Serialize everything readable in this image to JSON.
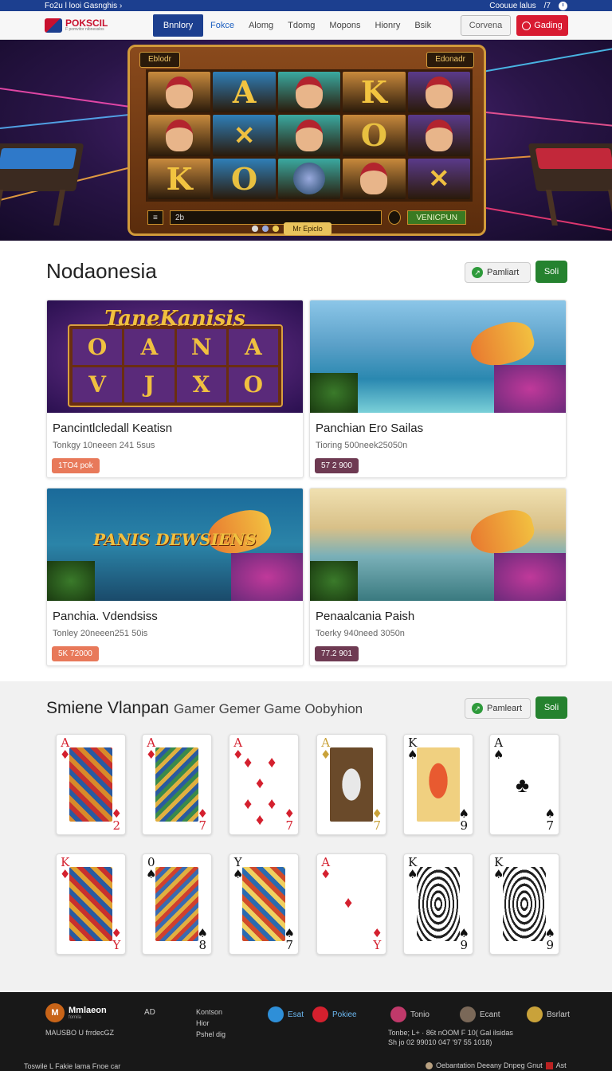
{
  "topbar": {
    "left": "Fo2u l looi Gasnghis",
    "left_arrow": "›",
    "right": "Coouue lalus",
    "right_num": "/7"
  },
  "nav": {
    "logo": "POKSCIL",
    "logo_tag": "F pomvitor nibnesslos",
    "items": [
      "Bnnlory",
      "Fokce",
      "Alomg",
      "Tdomg",
      "Mopons",
      "Hionry",
      "Bsik"
    ],
    "outline_btn": "Corvena",
    "red_btn": "Gading"
  },
  "hero": {
    "slot_title": "Eblodr",
    "slot_badge": "Edonadr",
    "bottom_left": "2b",
    "win_label": "VENICPUN",
    "control": "Mr Epiclo",
    "reel_symbols": [
      "face",
      "A",
      "face",
      "K",
      "face",
      "face",
      "swords",
      "face",
      "O",
      "face",
      "K",
      "O",
      "orb",
      "face",
      "swords"
    ]
  },
  "section1": {
    "title": "Nodaonesia",
    "pill_btn": "Pamliart",
    "green_btn": "Soli",
    "cards": [
      {
        "title": "Pancintlcledall Keatisn",
        "meta": "Tonkgy 10neeen 241 5sus",
        "badge": "1TO4 pok",
        "badge_color": "#e8795a",
        "banner": "TaneKanisis",
        "img": "slot"
      },
      {
        "title": "Panchian Ero Sailas",
        "meta": "Tioring 500neek25050n",
        "badge": "57 2 900",
        "badge_color": "#6e3a52",
        "banner": "",
        "img": "lake"
      },
      {
        "title": "Panchia. Vdendsiss",
        "meta": "Tonley 20neeen251 50is",
        "badge": "5K 72000",
        "badge_color": "#e8795a",
        "banner": "PANIS DEWSIENS",
        "img": "reef"
      },
      {
        "title": "Penaalcania Paish",
        "meta": "Toerky 940need 3050n",
        "badge": "77.2 901",
        "badge_color": "#6e3a52",
        "banner": "",
        "img": "sunset"
      }
    ]
  },
  "section2": {
    "title": "Smiene Vlanpan",
    "subtitle": "Gamer Gemer Game Oobyhion",
    "pill_btn": "Pamleart",
    "green_btn": "Soli",
    "cards": [
      {
        "rank": "A",
        "suit": "♦",
        "rank2": "2",
        "color": "#d4202e",
        "art": "pattern1"
      },
      {
        "rank": "A",
        "suit": "♦",
        "rank2": "7",
        "color": "#d4202e",
        "art": "pattern2"
      },
      {
        "rank": "A",
        "suit": "♦",
        "rank2": "7",
        "color": "#d4202e",
        "art": "pips"
      },
      {
        "rank": "A",
        "suit": "♦",
        "rank2": "7",
        "color": "#c9a23a",
        "art": "skull"
      },
      {
        "rank": "K",
        "suit": "♠",
        "rank2": "9",
        "color": "#111111",
        "art": "fish"
      },
      {
        "rank": "A",
        "suit": "♠",
        "rank2": "7",
        "color": "#111111",
        "art": "club"
      },
      {
        "rank": "K",
        "suit": "♦",
        "rank2": "Y",
        "color": "#d4202e",
        "art": "pattern3"
      },
      {
        "rank": "0",
        "suit": "♠",
        "rank2": "8",
        "color": "#111111",
        "art": "pattern4"
      },
      {
        "rank": "Y",
        "suit": "♠",
        "rank2": "7",
        "color": "#111111",
        "art": "pattern5"
      },
      {
        "rank": "A",
        "suit": "♦",
        "rank2": "Y",
        "color": "#d4202e",
        "art": "single"
      },
      {
        "rank": "K",
        "suit": "♠",
        "rank2": "9",
        "color": "#111111",
        "art": "mandala"
      },
      {
        "rank": "K",
        "suit": "♠",
        "rank2": "9",
        "color": "#111111",
        "art": "mandala2"
      }
    ]
  },
  "footer": {
    "brand": "Mmlaeon",
    "brand_sub": "fomila",
    "col_ad": "AD",
    "col_links": [
      "Kontson",
      "Hior",
      "Pshel dig"
    ],
    "socials": [
      {
        "label": "Esat",
        "color": "#2e8fd8"
      },
      {
        "label": "Pokiee",
        "color": "#d4202e"
      },
      {
        "label": "Tonio",
        "color": "#c0396a"
      },
      {
        "label": "Ecant",
        "color": "#7a6858"
      },
      {
        "label": "Bsrlart",
        "color": "#c9a23a"
      }
    ],
    "left_small": "MAUSBO U frrdecGZ",
    "right_small_1": "Tonbe; L+ · 86t nOOM F 10( Gal ilsidas",
    "right_small_2": "Sh jo 02 99010 047 '97 55 1018)",
    "bottom_left": "Toswile L Fakie lama Fnoe car",
    "bottom_right": "Oebantation Deeany Dnpeg Gnut",
    "bottom_right_end": "Ast"
  }
}
